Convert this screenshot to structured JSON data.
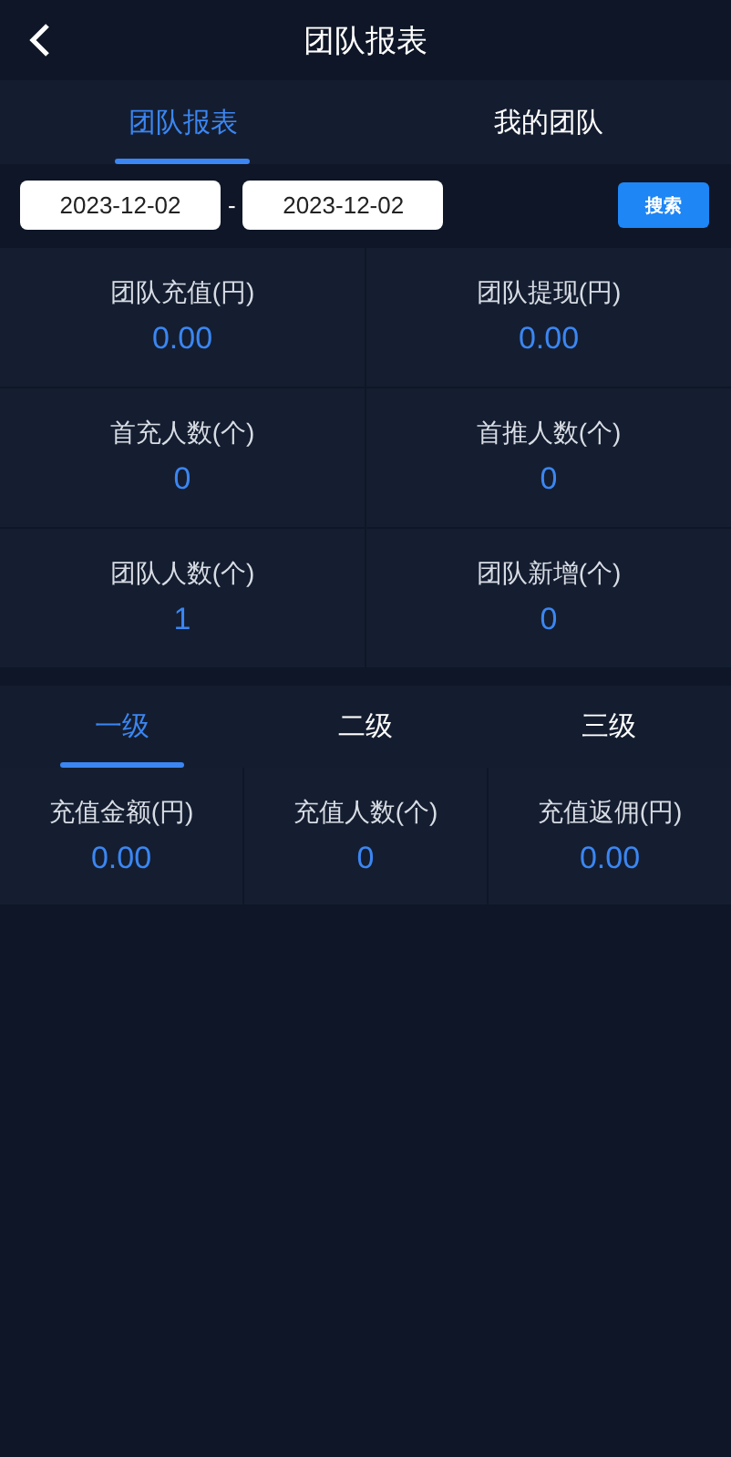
{
  "header": {
    "title": "团队报表"
  },
  "tabs": [
    {
      "label": "团队报表",
      "selected": true
    },
    {
      "label": "我的团队",
      "selected": false
    }
  ],
  "filter": {
    "start": "2023-12-02",
    "separator": "-",
    "end": "2023-12-02",
    "button": "搜索"
  },
  "stats": [
    {
      "label": "团队充值(円)",
      "value": "0.00"
    },
    {
      "label": "团队提现(円)",
      "value": "0.00"
    },
    {
      "label": "首充人数(个)",
      "value": "0"
    },
    {
      "label": "首推人数(个)",
      "value": "0"
    },
    {
      "label": "团队人数(个)",
      "value": "1"
    },
    {
      "label": "团队新增(个)",
      "value": "0"
    }
  ],
  "levels": [
    {
      "label": "一级",
      "selected": true
    },
    {
      "label": "二级",
      "selected": false
    },
    {
      "label": "三级",
      "selected": false
    }
  ],
  "level_stats": [
    {
      "label": "充值金额(円)",
      "value": "0.00"
    },
    {
      "label": "充值人数(个)",
      "value": "0"
    },
    {
      "label": "充值返佣(円)",
      "value": "0.00"
    }
  ]
}
